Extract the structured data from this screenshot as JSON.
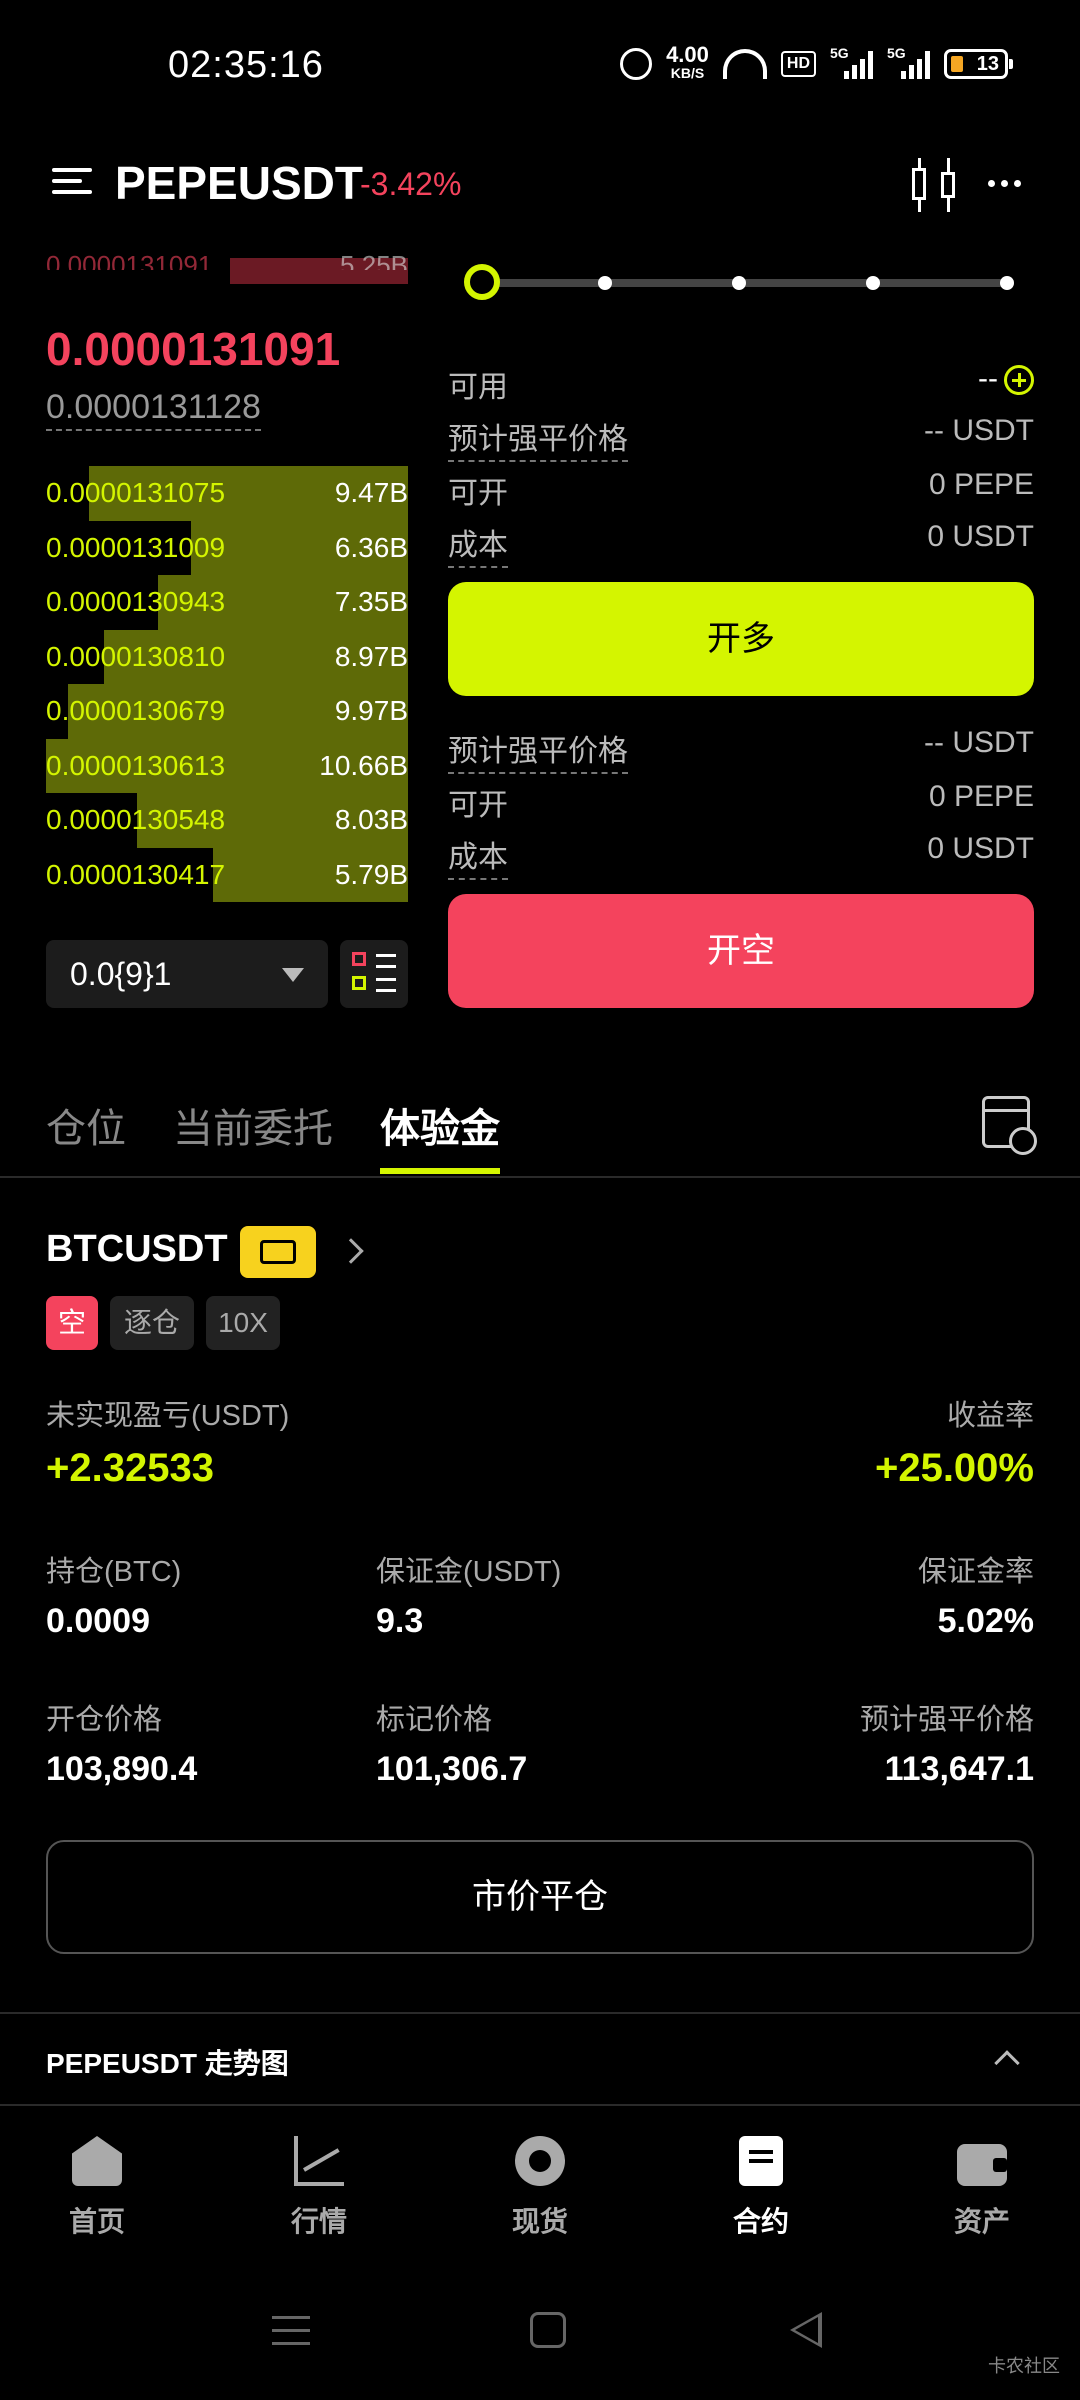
{
  "status_bar": {
    "time": "02:35:16",
    "net_speed_value": "4.00",
    "net_speed_unit": "KB/S",
    "hd_label": "HD",
    "sim1_label": "5G",
    "sim2_label": "5G",
    "battery_level": "13"
  },
  "header": {
    "pair": "PEPEUSDT",
    "change": "-3.42%"
  },
  "order_book": {
    "top_ask_partial_price": "0.0000131091",
    "top_ask_partial_qty": "5.25B",
    "last_price": "0.0000131091",
    "mark_price": "0.0000131128",
    "bids": [
      {
        "price": "0.0000131075",
        "qty": "9.47B",
        "depth": 0.88
      },
      {
        "price": "0.0000131009",
        "qty": "6.36B",
        "depth": 0.6
      },
      {
        "price": "0.0000130943",
        "qty": "7.35B",
        "depth": 0.69
      },
      {
        "price": "0.0000130810",
        "qty": "8.97B",
        "depth": 0.84
      },
      {
        "price": "0.0000130679",
        "qty": "9.97B",
        "depth": 0.94
      },
      {
        "price": "0.0000130613",
        "qty": "10.66B",
        "depth": 1.0
      },
      {
        "price": "0.0000130548",
        "qty": "8.03B",
        "depth": 0.75
      },
      {
        "price": "0.0000130417",
        "qty": "5.79B",
        "depth": 0.54
      }
    ],
    "precision": "0.0{9}1"
  },
  "trade_panel": {
    "slider_percent": 0,
    "available_label": "可用",
    "available_value": "--",
    "long": {
      "liq_label": "预计强平价格",
      "liq_value": "-- USDT",
      "openable_label": "可开",
      "openable_value": "0 PEPE",
      "cost_label": "成本",
      "cost_value": "0 USDT",
      "button": "开多"
    },
    "short": {
      "liq_label": "预计强平价格",
      "liq_value": "-- USDT",
      "openable_label": "可开",
      "openable_value": "0 PEPE",
      "cost_label": "成本",
      "cost_value": "0 USDT",
      "button": "开空"
    }
  },
  "tabs": [
    "仓位",
    "当前委托",
    "体验金"
  ],
  "position": {
    "symbol": "BTCUSDT",
    "side": "空",
    "margin_mode": "逐仓",
    "leverage": "10X",
    "pnl_label": "未实现盈亏(USDT)",
    "pnl_value": "+2.32533",
    "roe_label": "收益率",
    "roe_value": "+25.00%",
    "size_label": "持仓(BTC)",
    "size_value": "0.0009",
    "margin_label": "保证金(USDT)",
    "margin_value": "9.3",
    "margin_ratio_label": "保证金率",
    "margin_ratio_value": "5.02%",
    "entry_label": "开仓价格",
    "entry_value": "103,890.4",
    "mark_label": "标记价格",
    "mark_value": "101,306.7",
    "liq_label": "预计强平价格",
    "liq_value": "113,647.1",
    "close_button": "市价平仓"
  },
  "trend": {
    "title": "PEPEUSDT 走势图"
  },
  "bottom_nav": [
    {
      "label": "首页",
      "icon": "home-icon"
    },
    {
      "label": "行情",
      "icon": "market-icon"
    },
    {
      "label": "现货",
      "icon": "spot-icon"
    },
    {
      "label": "合约",
      "icon": "contract-icon",
      "active": true
    },
    {
      "label": "资产",
      "icon": "wallet-icon"
    }
  ],
  "watermark": "卡农社区",
  "colors": {
    "accent": "#d4f500",
    "down": "#f4435d",
    "bid_bar": "#5e6a07",
    "coupon": "#f7d21e"
  }
}
